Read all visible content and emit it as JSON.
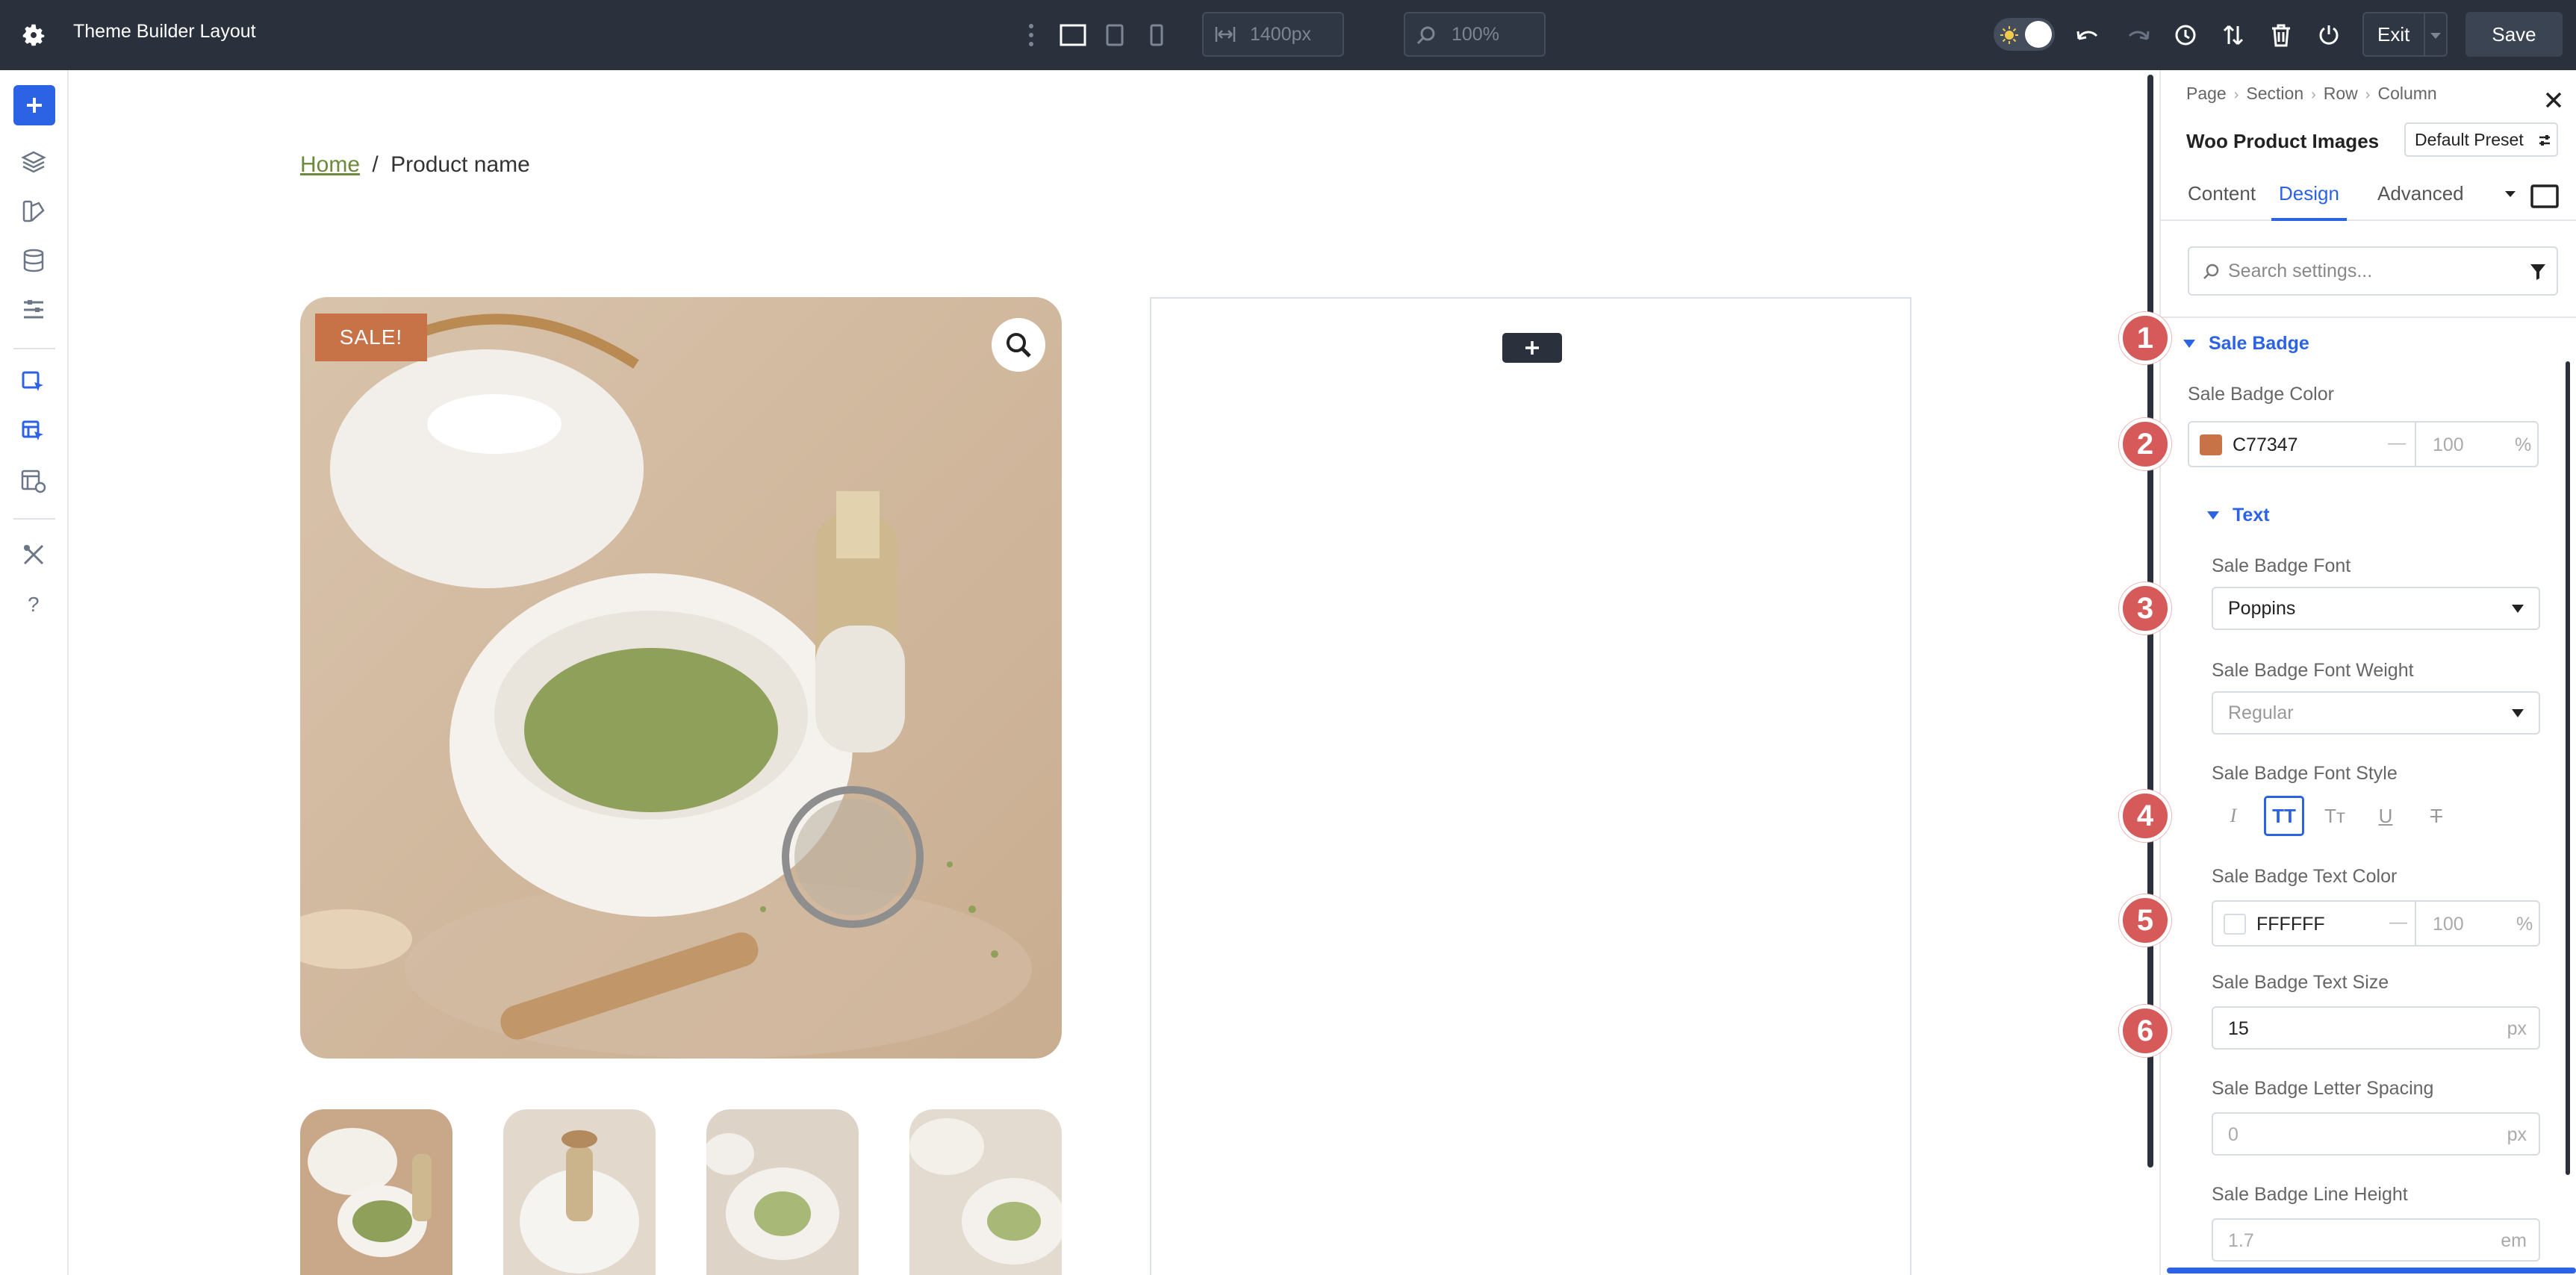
{
  "topbar": {
    "title": "Theme Builder Layout",
    "width_value": "1400px",
    "zoom_value": "100%",
    "exit_label": "Exit",
    "save_label": "Save"
  },
  "canvas": {
    "breadcrumb_home": "Home",
    "breadcrumb_sep": "/",
    "breadcrumb_current": "Product name",
    "sale_badge": "SALE!"
  },
  "markers": [
    "1",
    "2",
    "3",
    "4",
    "5",
    "6"
  ],
  "panel": {
    "crumbs": [
      "Page",
      "Section",
      "Row",
      "Column"
    ],
    "module_title": "Woo Product Images",
    "preset_label": "Default Preset",
    "tabs": [
      "Content",
      "Design",
      "Advanced"
    ],
    "active_tab": "Design",
    "search_placeholder": "Search settings...",
    "section_title": "Sale Badge",
    "sale_badge_color_label": "Sale Badge Color",
    "sale_badge_color": {
      "hex": "C77347",
      "swatch": "#c77347",
      "dash": "—",
      "opacity": "100",
      "unit": "%"
    },
    "text_section_title": "Text",
    "font_label": "Sale Badge Font",
    "font_value": "Poppins",
    "font_weight_label": "Sale Badge Font Weight",
    "font_weight_value": "Regular",
    "font_style_label": "Sale Badge Font Style",
    "font_style_buttons": [
      "I",
      "TT",
      "Tт",
      "U",
      "T"
    ],
    "text_color_label": "Sale Badge Text Color",
    "text_color": {
      "hex": "FFFFFF",
      "swatch": "#ffffff",
      "dash": "—",
      "opacity": "100",
      "unit": "%"
    },
    "text_size_label": "Sale Badge Text Size",
    "text_size_value": "15",
    "text_size_unit": "px",
    "letter_spacing_label": "Sale Badge Letter Spacing",
    "letter_spacing_value": "0",
    "letter_spacing_unit": "px",
    "line_height_label": "Sale Badge Line Height",
    "line_height_value": "1.7",
    "line_height_unit": "em"
  },
  "colors": {
    "accent": "#2c63e4",
    "topbar": "#2a313d",
    "marker": "#d65a5a",
    "badge": "#c77347"
  }
}
